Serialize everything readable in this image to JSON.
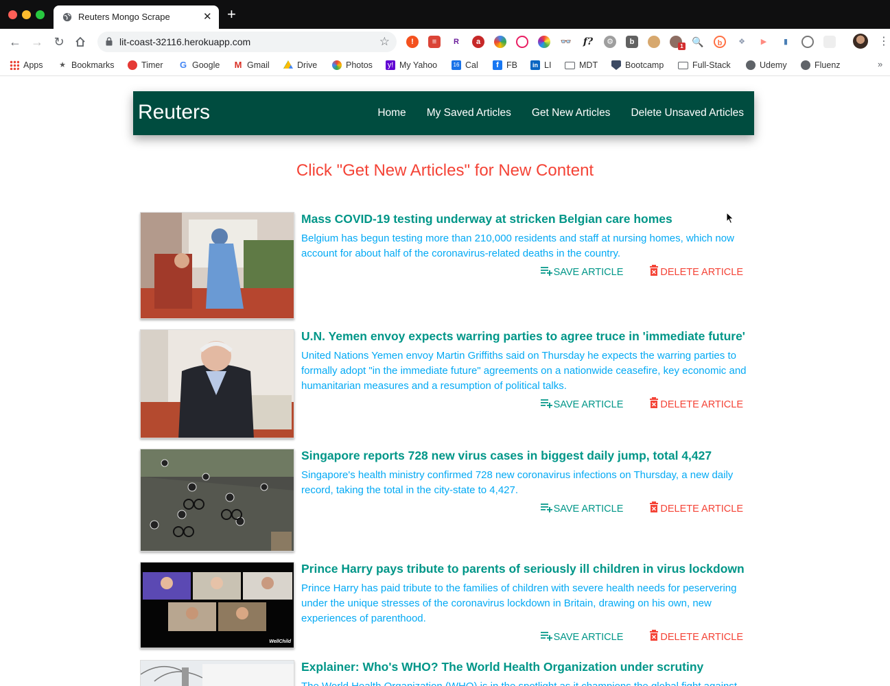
{
  "browser": {
    "tab_title": "Reuters Mongo Scrape",
    "url": "lit-coast-32116.herokuapp.com",
    "bookmarks": [
      "Apps",
      "Bookmarks",
      "Timer",
      "Google",
      "Gmail",
      "Drive",
      "Photos",
      "My Yahoo",
      "Cal",
      "FB",
      "LI",
      "MDT",
      "Bootcamp",
      "Full-Stack",
      "Udemy",
      "Fluenz"
    ],
    "bookmark_more": "»"
  },
  "navbar": {
    "brand": "Reuters",
    "links": [
      "Home",
      "My Saved Articles",
      "Get New Articles",
      "Delete Unsaved Articles"
    ]
  },
  "headline": "Click \"Get New Articles\" for New Content",
  "actions": {
    "save": "SAVE ARTICLE",
    "delete": "DELETE ARTICLE"
  },
  "articles": [
    {
      "title": "Mass COVID-19 testing underway at stricken Belgian care homes",
      "summary": "Belgium has begun testing more than 210,000 residents and staff at nursing homes, which now account for about half of the coronavirus-related deaths in the country."
    },
    {
      "title": "U.N. Yemen envoy expects warring parties to agree truce in 'immediate future'",
      "summary": "United Nations Yemen envoy Martin Griffiths said on Thursday he expects the warring parties to formally adopt \"in the immediate future\" agreements on a nationwide ceasefire, key economic and humanitarian measures and a resumption of political talks."
    },
    {
      "title": "Singapore reports 728 new virus cases in biggest daily jump, total 4,427",
      "summary": "Singapore's health ministry confirmed 728 new coronavirus infections on Thursday, a new daily record, taking the total in the city-state to 4,427."
    },
    {
      "title": "Prince Harry pays tribute to parents of seriously ill children in virus lockdown",
      "summary": "Prince Harry has paid tribute to the families of children with severe health needs for peservering under the unique stresses of the coronavirus lockdown in Britain, drawing on his own, new experiences of parenthood.",
      "image_caption": "WellChild"
    },
    {
      "title": "Explainer: Who's WHO? The World Health Organization under scrutiny",
      "summary": "The World Health Organization (WHO) is in the spotlight as it champions the global fight against"
    }
  ]
}
